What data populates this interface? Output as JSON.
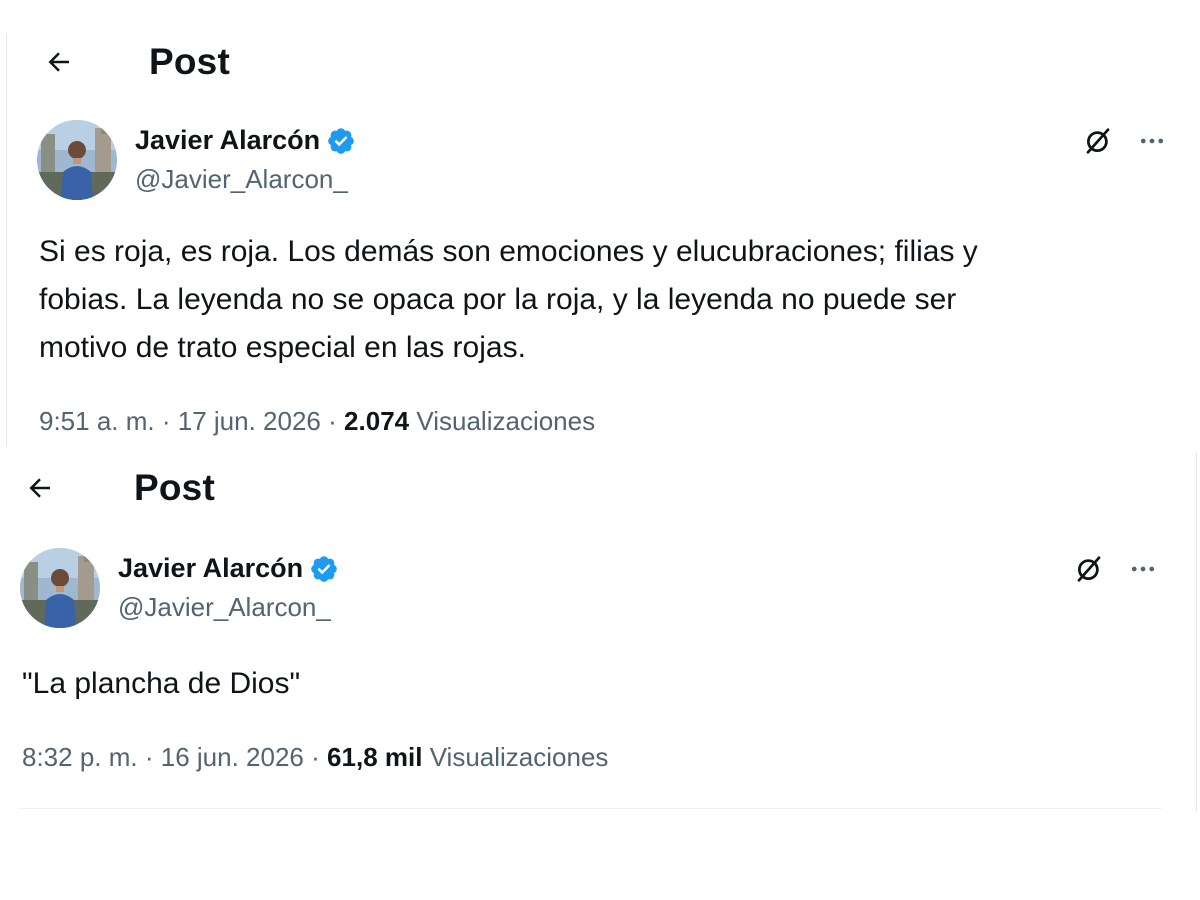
{
  "posts": [
    {
      "header_title": "Post",
      "author": {
        "display_name": "Javier Alarcón",
        "handle": "@Javier_Alarcon_"
      },
      "text": "Si es roja, es roja. Los demás son emociones y elucubraciones; filias y\nfobias. La leyenda no se opaca por la roja, y la leyenda no puede ser\nmotivo de trato especial en las rojas.",
      "time": "9:51 a. m.",
      "separator": "·",
      "date": "17 jun. 2026",
      "views_count": "2.074",
      "views_label": "Visualizaciones"
    },
    {
      "header_title": "Post",
      "author": {
        "display_name": "Javier Alarcón",
        "handle": "@Javier_Alarcon_"
      },
      "text": "\"La plancha de Dios\"",
      "time": "8:32 p. m.",
      "separator": "·",
      "date": "16 jun. 2026",
      "views_count": "61,8 mil",
      "views_label": "Visualizaciones"
    }
  ],
  "icons": {
    "back": "arrow-left-icon",
    "verified": "verified-badge-icon",
    "grok": "grok-icon",
    "more": "more-options-icon"
  },
  "colors": {
    "text": "#0f1419",
    "secondary": "#536471",
    "verified": "#1d9bf0",
    "divider": "#eff3f4"
  }
}
